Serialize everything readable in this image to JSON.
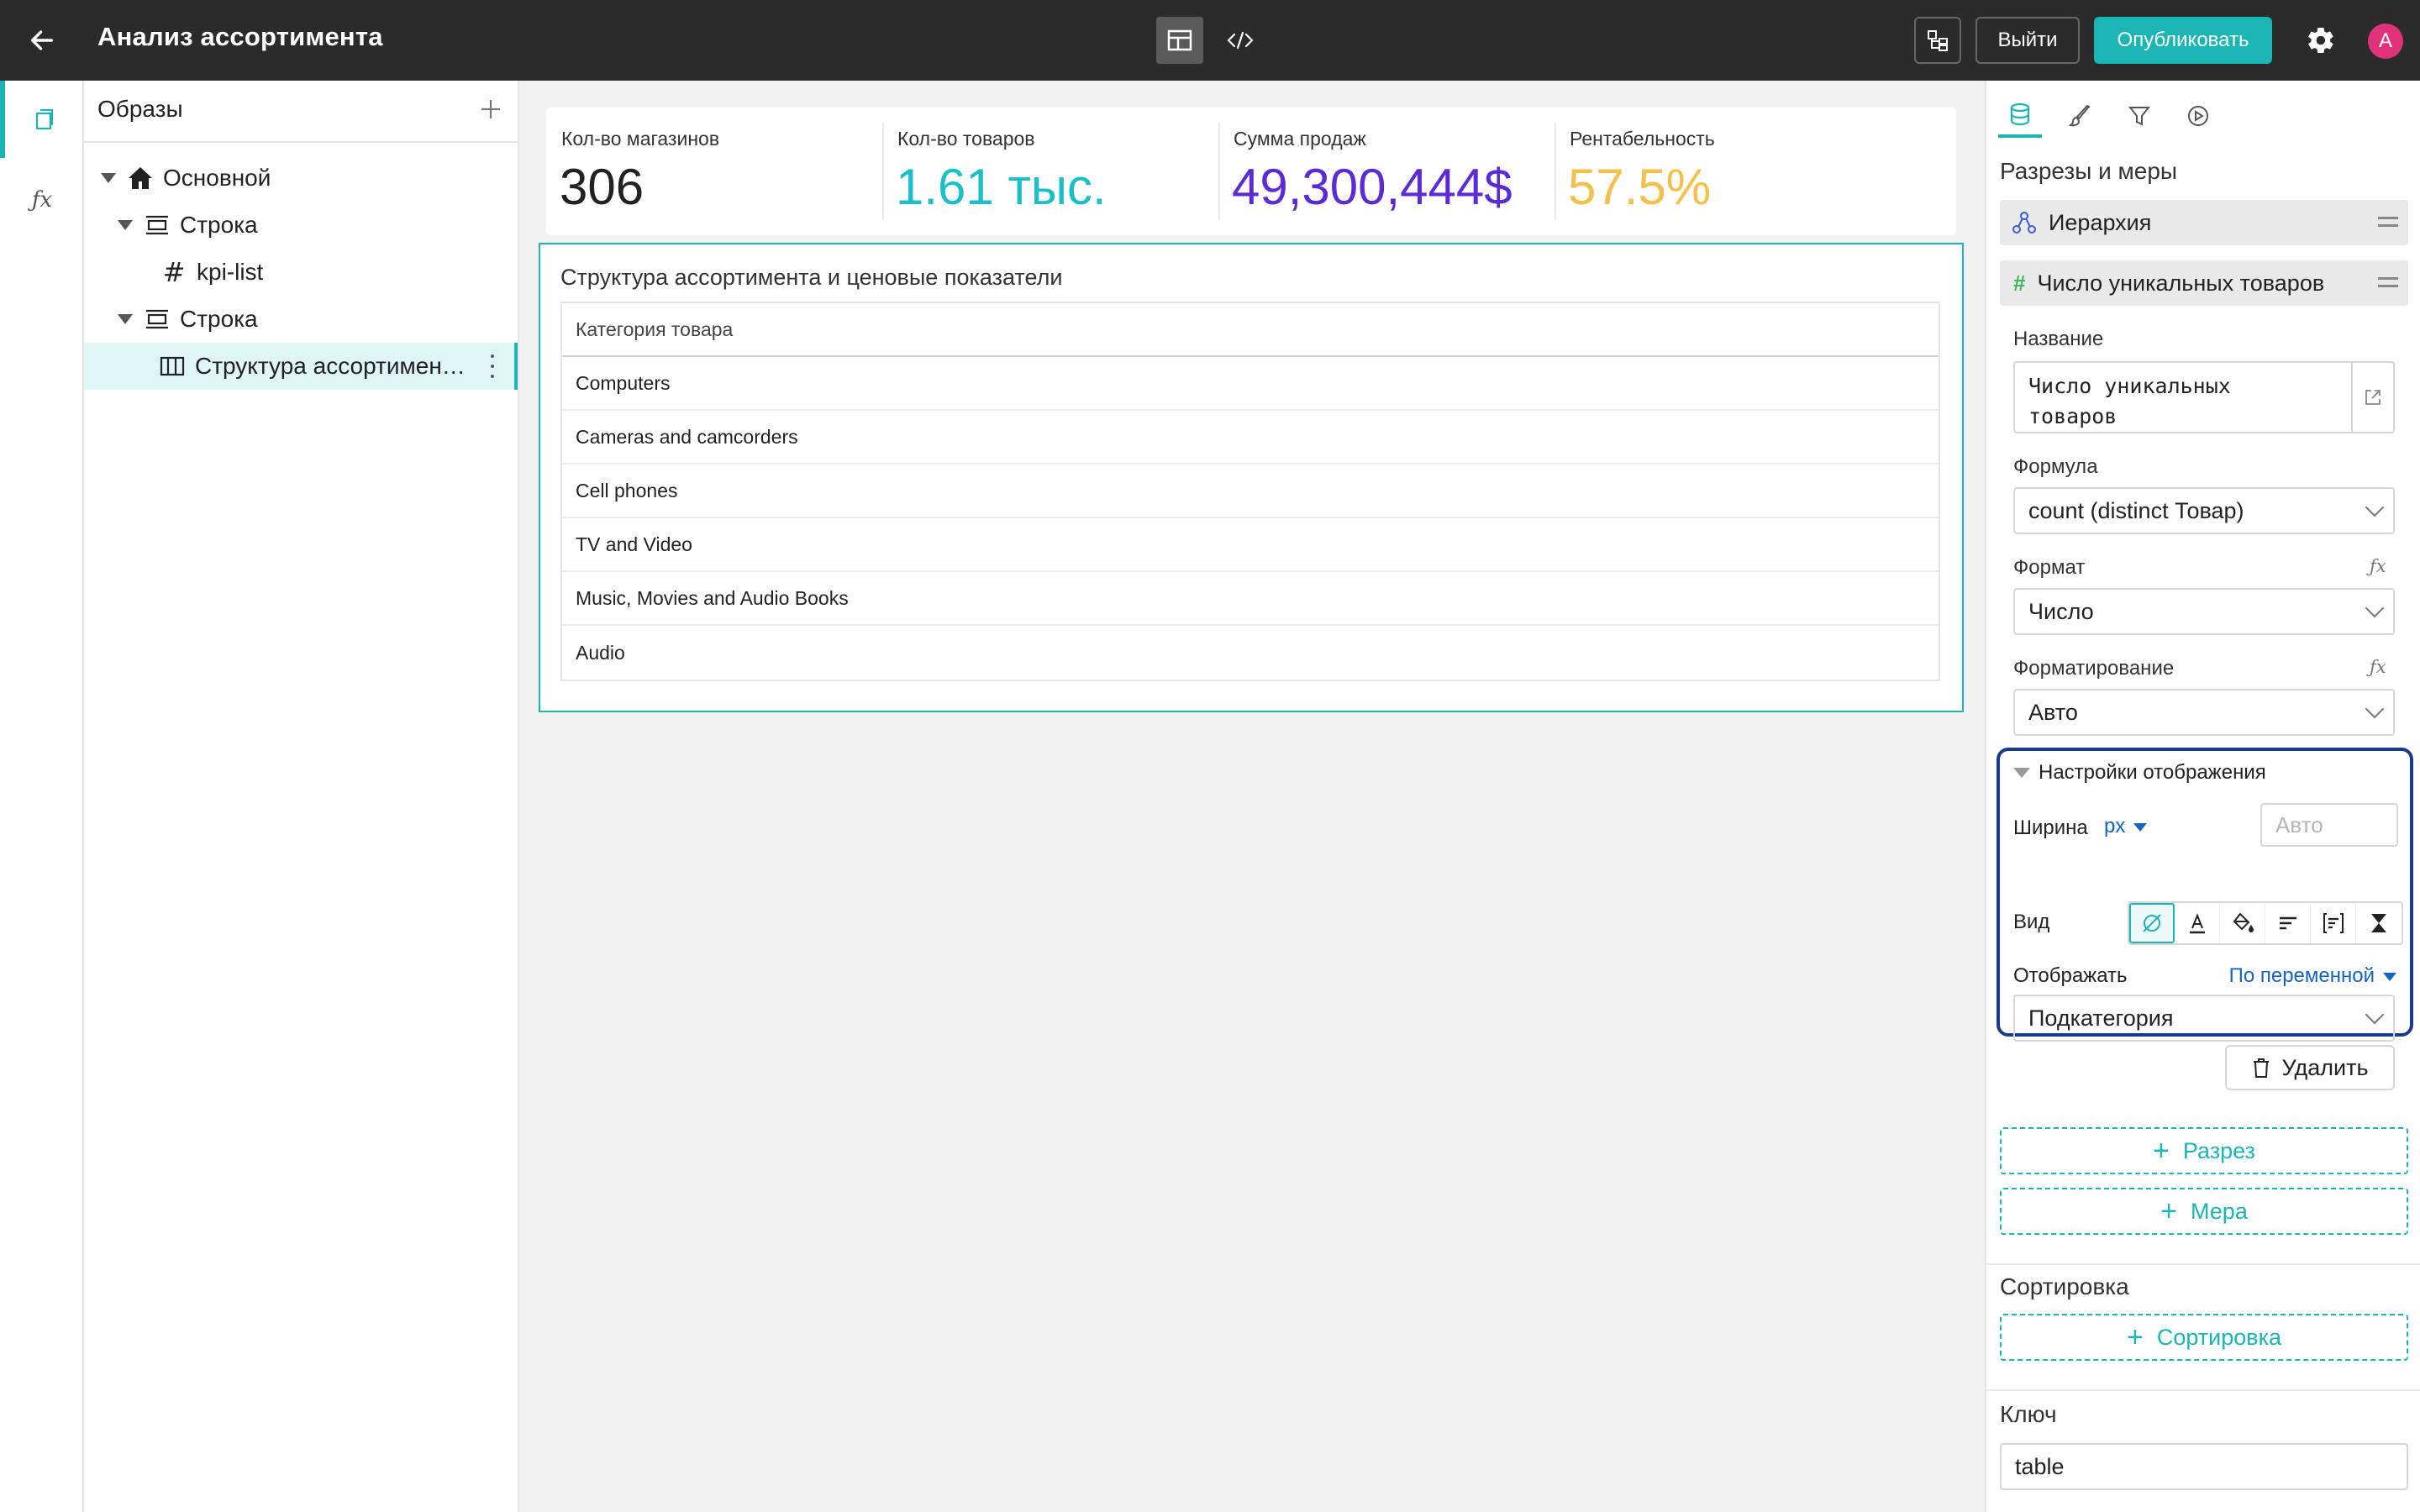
{
  "header": {
    "title": "Анализ ассортимента",
    "exit_label": "Выйти",
    "publish_label": "Опубликовать",
    "avatar_letter": "A",
    "accent": "#1bb5b5"
  },
  "tree": {
    "title": "Образы",
    "items": [
      {
        "label": "Основной",
        "icon": "home-icon"
      },
      {
        "label": "Строка",
        "icon": "row-icon"
      },
      {
        "label": "kpi-list",
        "icon": "hash-icon"
      },
      {
        "label": "Строка",
        "icon": "row-icon"
      },
      {
        "label": "Структура ассортимен…",
        "icon": "table-icon",
        "selected": true
      }
    ]
  },
  "kpis": [
    {
      "label": "Кол-во магазинов",
      "value": "306",
      "color": "#222222"
    },
    {
      "label": "Кол-во товаров",
      "value": "1.61 тыс.",
      "color": "#1bbfc9"
    },
    {
      "label": "Сумма продаж",
      "value": "49,300,444$",
      "color": "#5b2bd6"
    },
    {
      "label": "Рентабельность",
      "value": "57.5%",
      "color": "#f5c04a"
    }
  ],
  "table": {
    "title": "Структура ассортимента и ценовые показатели",
    "header": "Категория товара",
    "rows": [
      "Computers",
      "Cameras and camcorders",
      "Cell phones",
      "TV and Video",
      "Music, Movies and Audio Books",
      "Audio"
    ]
  },
  "panel": {
    "section_title": "Разрезы и меры",
    "hierarchy_label": "Иерархия",
    "measure_label": "Число уникальных товаров",
    "name_label": "Название",
    "name_value_line1": "Число уникальных",
    "name_value_line2": "товаров",
    "formula_label": "Формула",
    "formula_value": "count (distinct Товар)",
    "format_label": "Формат",
    "format_value": "Число",
    "formatting_label": "Форматирование",
    "formatting_value": "Авто",
    "fx": "ƒx",
    "display": {
      "title": "Настройки отображения",
      "width_label": "Ширина",
      "width_unit": "px",
      "width_placeholder": "Авто",
      "view_label": "Вид",
      "show_label": "Отображать",
      "show_mode": "По переменной",
      "show_value": "Подкатегория"
    },
    "delete_label": "Удалить",
    "add_slice_label": "Разрез",
    "add_measure_label": "Мера",
    "sort_title": "Сортировка",
    "add_sort_label": "Сортировка",
    "key_title": "Ключ",
    "key_value": "table"
  }
}
